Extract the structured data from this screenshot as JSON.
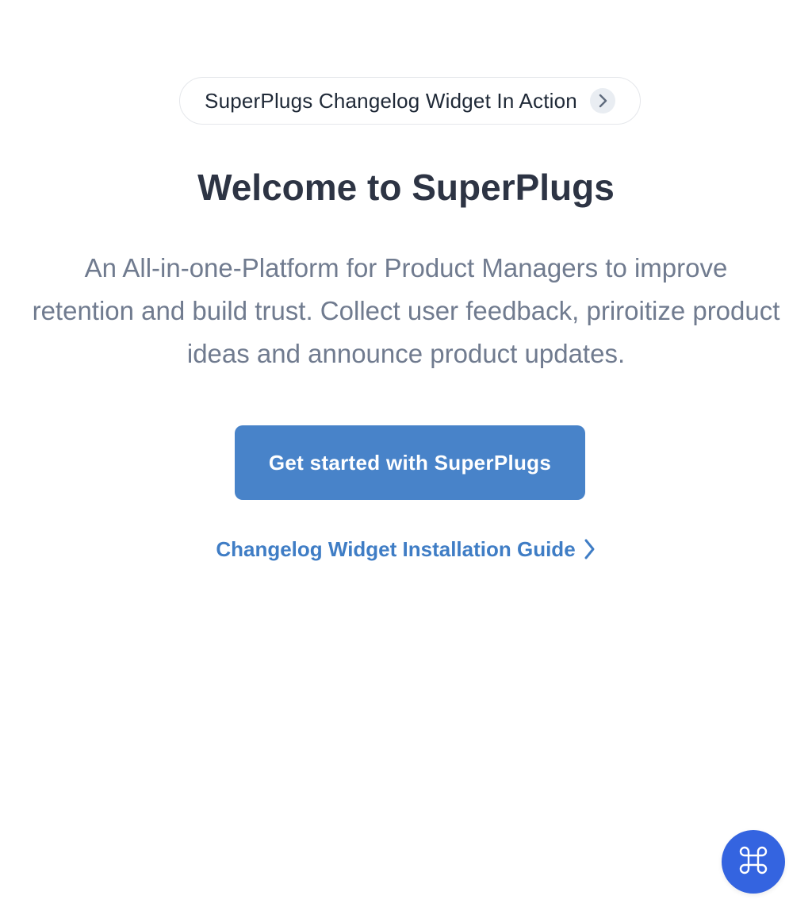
{
  "announcement": {
    "label": "SuperPlugs Changelog Widget In Action",
    "icon": "chevron-right-icon"
  },
  "hero": {
    "title": "Welcome to SuperPlugs",
    "description": "An All-in-one-Platform for Product Managers to improve retention and build trust. Collect user feedback, priroitize product ideas and announce product updates."
  },
  "actions": {
    "primary_label": "Get started with SuperPlugs",
    "guide_link_label": "Changelog Widget Installation Guide",
    "guide_link_icon": "chevron-right-icon"
  },
  "fab": {
    "icon": "command-key-icon"
  },
  "colors": {
    "primary_button": "#4883c9",
    "link": "#3f7dc5",
    "fab": "#3464e0",
    "title": "#2d3444",
    "description": "#707b8f"
  }
}
